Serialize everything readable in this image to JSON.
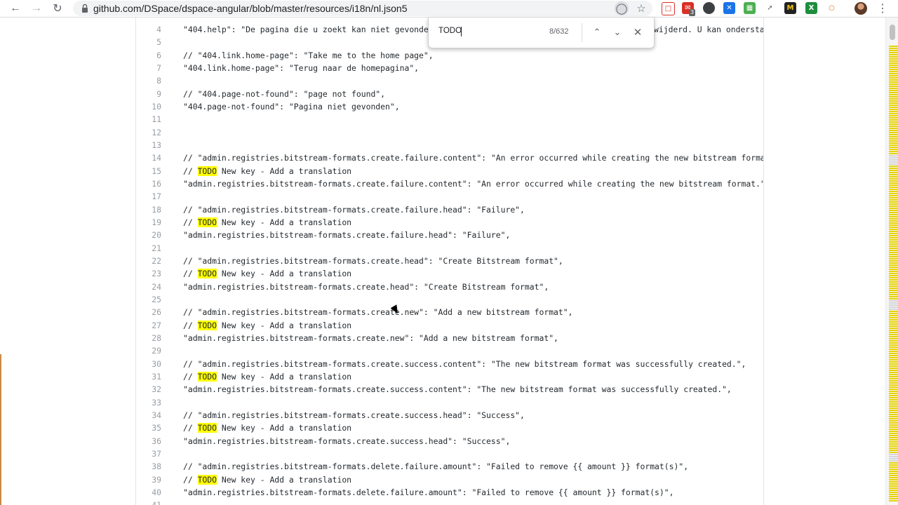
{
  "browser": {
    "url": "github.com/DSpace/dspace-angular/blob/master/resources/i18n/nl.json5",
    "extension_badge": "3"
  },
  "find": {
    "query": "TODO",
    "count": "8/632"
  },
  "code_lines": [
    {
      "n": "4",
      "pre": "\"404.help\": \"De pagina die u zoekt kan niet gevonden",
      "hl": "",
      "post": "",
      "tail": "wijderd. U kan ondersta"
    },
    {
      "n": "5",
      "pre": "",
      "hl": "",
      "post": ""
    },
    {
      "n": "6",
      "pre": "// \"404.link.home-page\": \"Take me to the home page\",",
      "hl": "",
      "post": ""
    },
    {
      "n": "7",
      "pre": "\"404.link.home-page\": \"Terug naar de homepagina\",",
      "hl": "",
      "post": ""
    },
    {
      "n": "8",
      "pre": "",
      "hl": "",
      "post": ""
    },
    {
      "n": "9",
      "pre": "// \"404.page-not-found\": \"page not found\",",
      "hl": "",
      "post": ""
    },
    {
      "n": "10",
      "pre": "\"404.page-not-found\": \"Pagina niet gevonden\",",
      "hl": "",
      "post": ""
    },
    {
      "n": "11",
      "pre": "",
      "hl": "",
      "post": ""
    },
    {
      "n": "12",
      "pre": "",
      "hl": "",
      "post": ""
    },
    {
      "n": "13",
      "pre": "",
      "hl": "",
      "post": ""
    },
    {
      "n": "14",
      "pre": "// \"admin.registries.bitstream-formats.create.failure.content\": \"An error occurred while creating the new bitstream format.\",",
      "hl": "",
      "post": ""
    },
    {
      "n": "15",
      "pre": "// ",
      "hl": "TODO",
      "post": " New key - Add a translation"
    },
    {
      "n": "16",
      "pre": "\"admin.registries.bitstream-formats.create.failure.content\": \"An error occurred while creating the new bitstream format.\",",
      "hl": "",
      "post": ""
    },
    {
      "n": "17",
      "pre": "",
      "hl": "",
      "post": ""
    },
    {
      "n": "18",
      "pre": "// \"admin.registries.bitstream-formats.create.failure.head\": \"Failure\",",
      "hl": "",
      "post": ""
    },
    {
      "n": "19",
      "pre": "// ",
      "hl": "TODO",
      "post": " New key - Add a translation"
    },
    {
      "n": "20",
      "pre": "\"admin.registries.bitstream-formats.create.failure.head\": \"Failure\",",
      "hl": "",
      "post": ""
    },
    {
      "n": "21",
      "pre": "",
      "hl": "",
      "post": ""
    },
    {
      "n": "22",
      "pre": "// \"admin.registries.bitstream-formats.create.head\": \"Create Bitstream format\",",
      "hl": "",
      "post": ""
    },
    {
      "n": "23",
      "pre": "// ",
      "hl": "TODO",
      "post": " New key - Add a translation"
    },
    {
      "n": "24",
      "pre": "\"admin.registries.bitstream-formats.create.head\": \"Create Bitstream format\",",
      "hl": "",
      "post": ""
    },
    {
      "n": "25",
      "pre": "",
      "hl": "",
      "post": ""
    },
    {
      "n": "26",
      "pre": "// \"admin.registries.bitstream-formats.create.new\": \"Add a new bitstream format\",",
      "hl": "",
      "post": ""
    },
    {
      "n": "27",
      "pre": "// ",
      "hl": "TODO",
      "post": " New key - Add a translation"
    },
    {
      "n": "28",
      "pre": "\"admin.registries.bitstream-formats.create.new\": \"Add a new bitstream format\",",
      "hl": "",
      "post": ""
    },
    {
      "n": "29",
      "pre": "",
      "hl": "",
      "post": ""
    },
    {
      "n": "30",
      "pre": "// \"admin.registries.bitstream-formats.create.success.content\": \"The new bitstream format was successfully created.\",",
      "hl": "",
      "post": ""
    },
    {
      "n": "31",
      "pre": "// ",
      "hl": "TODO",
      "post": " New key - Add a translation"
    },
    {
      "n": "32",
      "pre": "\"admin.registries.bitstream-formats.create.success.content\": \"The new bitstream format was successfully created.\",",
      "hl": "",
      "post": ""
    },
    {
      "n": "33",
      "pre": "",
      "hl": "",
      "post": ""
    },
    {
      "n": "34",
      "pre": "// \"admin.registries.bitstream-formats.create.success.head\": \"Success\",",
      "hl": "",
      "post": ""
    },
    {
      "n": "35",
      "pre": "// ",
      "hl": "TODO",
      "post": " New key - Add a translation"
    },
    {
      "n": "36",
      "pre": "\"admin.registries.bitstream-formats.create.success.head\": \"Success\",",
      "hl": "",
      "post": ""
    },
    {
      "n": "37",
      "pre": "",
      "hl": "",
      "post": ""
    },
    {
      "n": "38",
      "pre": "// \"admin.registries.bitstream-formats.delete.failure.amount\": \"Failed to remove {{ amount }} format(s)\",",
      "hl": "",
      "post": ""
    },
    {
      "n": "39",
      "pre": "// ",
      "hl": "TODO",
      "post": " New key - Add a translation"
    },
    {
      "n": "40",
      "pre": "\"admin.registries.bitstream-formats.delete.failure.amount\": \"Failed to remove {{ amount }} format(s)\",",
      "hl": "",
      "post": ""
    },
    {
      "n": "41",
      "pre": "",
      "hl": "",
      "post": ""
    }
  ],
  "colors": {
    "highlight": "#ffff00",
    "scroll_marker": "#e8d400"
  }
}
